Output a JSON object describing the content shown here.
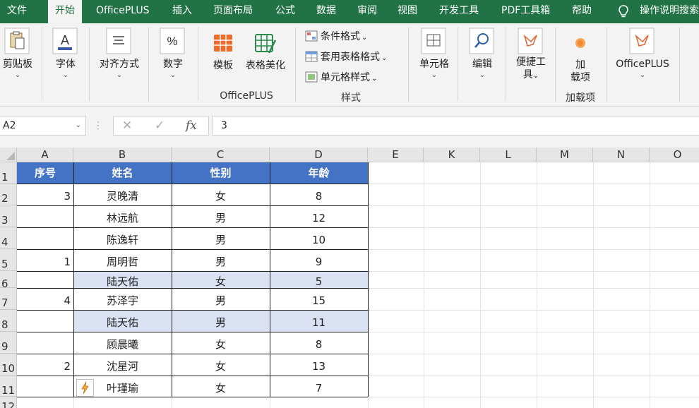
{
  "menu": {
    "tabs": [
      "文件",
      "开始",
      "OfficePLUS",
      "插入",
      "页面布局",
      "公式",
      "数据",
      "审阅",
      "视图",
      "开发工具",
      "PDF工具箱",
      "帮助"
    ],
    "active": "开始",
    "tell_me": "操作说明搜索"
  },
  "ribbon": {
    "clipboard": "剪贴板",
    "font": "字体",
    "align": "对齐方式",
    "number": "数字",
    "template": "模板",
    "beautify": "表格美化",
    "officeplus_group": "OfficePLUS",
    "cond_format": "条件格式",
    "table_format": "套用表格格式",
    "cell_style": "单元格样式",
    "styles_group": "样式",
    "cells": "单元格",
    "edit": "编辑",
    "convenient_line1": "便捷工",
    "convenient_line2": "具",
    "addins_line1": "加",
    "addins_line2": "载项",
    "addins_group": "加载项",
    "officeplus2": "OfficePLUS",
    "caret": "⌄",
    "dropdown_arrow": "⌄"
  },
  "formula_bar": {
    "name_box": "A2",
    "cancel_icon": "✕",
    "enter_icon": "✓",
    "fx": "fx",
    "value": "3"
  },
  "sheet": {
    "columns": [
      "A",
      "B",
      "C",
      "D",
      "E",
      "K",
      "L",
      "M",
      "N",
      "O"
    ],
    "rows": [
      "1",
      "2",
      "3",
      "4",
      "5",
      "6",
      "7",
      "8",
      "9",
      "10",
      "11",
      "12"
    ],
    "table_header": [
      "序号",
      "姓名",
      "性别",
      "年龄"
    ],
    "table_rows": [
      [
        "3",
        "灵晚清",
        "女",
        "8"
      ],
      [
        "",
        "林远航",
        "男",
        "12"
      ],
      [
        "",
        "陈逸轩",
        "男",
        "10"
      ],
      [
        "1",
        "周明哲",
        "男",
        "9"
      ],
      [
        "",
        "陆天佑",
        "女",
        "5"
      ],
      [
        "4",
        "苏泽宇",
        "男",
        "15"
      ],
      [
        "",
        "陆天佑",
        "男",
        "11"
      ],
      [
        "",
        "顾晨曦",
        "女",
        "8"
      ],
      [
        "2",
        "沈星河",
        "女",
        "13"
      ],
      [
        "",
        "叶瑾瑜",
        "女",
        "7"
      ]
    ],
    "highlighted_rows": [
      6,
      8
    ],
    "colors": {
      "header_fill": "#4472c4",
      "highlight_fill": "#d9e1f2",
      "accent": "#217346"
    }
  }
}
